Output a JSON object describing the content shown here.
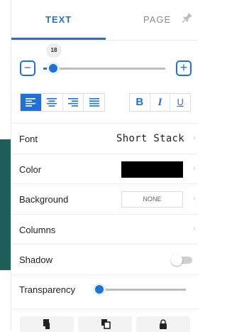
{
  "tabs": {
    "text": "TEXT",
    "page": "PAGE"
  },
  "size": {
    "value": "18",
    "level_fraction": 0.05
  },
  "align_active": "left",
  "style": {
    "bold": "B",
    "italic": "I",
    "underline": "U"
  },
  "rows": {
    "font_label": "Font",
    "font_value": "Short Stack",
    "color_label": "Color",
    "color_value": "#000000",
    "background_label": "Background",
    "background_value": "NONE",
    "columns_label": "Columns",
    "shadow_label": "Shadow",
    "shadow_on": false,
    "transparency_label": "Transparency",
    "transparency_fraction": 0.0
  },
  "colors": {
    "accent": "#1e72d6",
    "left_strip": "#1f5f5a"
  }
}
